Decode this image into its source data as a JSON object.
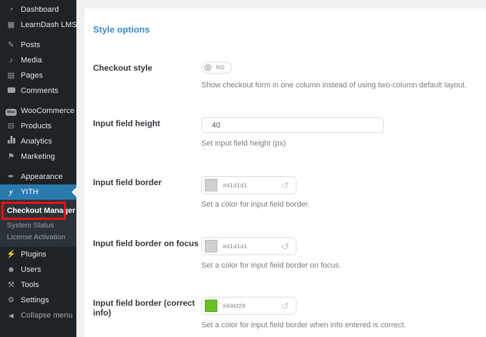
{
  "colors": {
    "sidebar_bg": "#1d2327",
    "submenu_bg": "#2c3338",
    "active_blue": "#2a7ab0",
    "heading_blue": "#3a8bc6",
    "annotation_red": "#f01111",
    "toggle_knob": "#d0d1d2",
    "border_gray_hex": "#d1d1d1",
    "correct_green_hex": "#69bf29"
  },
  "sidebar": {
    "items": [
      {
        "label": "Dashboard",
        "icon": "dashboard-icon",
        "glyph": "◔"
      },
      {
        "label": "LearnDash LMS",
        "icon": "learndash-icon",
        "glyph": "▦"
      },
      {
        "label": "Posts",
        "icon": "posts-pin-icon",
        "glyph": "✎"
      },
      {
        "label": "Media",
        "icon": "media-icon",
        "glyph": "♪"
      },
      {
        "label": "Pages",
        "icon": "pages-icon",
        "glyph": "▤"
      },
      {
        "label": "Comments",
        "icon": "comments-bubble-icon",
        "glyph": ""
      },
      {
        "label": "WooCommerce",
        "icon": "woocommerce-icon",
        "glyph": "Woo"
      },
      {
        "label": "Products",
        "icon": "products-icon",
        "glyph": "⊟"
      },
      {
        "label": "Analytics",
        "icon": "analytics-bars-icon",
        "glyph": ""
      },
      {
        "label": "Marketing",
        "icon": "marketing-megaphone-icon",
        "glyph": "⚑"
      },
      {
        "label": "Appearance",
        "icon": "appearance-brush-icon",
        "glyph": "✒"
      },
      {
        "label": "YITH",
        "icon": "yith-logo-icon",
        "glyph": "y"
      },
      {
        "label": "Plugins",
        "icon": "plugins-plug-icon",
        "glyph": "⚡"
      },
      {
        "label": "Users",
        "icon": "users-person-icon",
        "glyph": "☻"
      },
      {
        "label": "Tools",
        "icon": "tools-wrench-icon",
        "glyph": "⚒"
      },
      {
        "label": "Settings",
        "icon": "settings-sliders-icon",
        "glyph": "⚙"
      },
      {
        "label": "Collapse menu",
        "icon": "collapse-arrow-icon",
        "glyph": "◀"
      }
    ],
    "submenu": [
      {
        "label": "Checkout Manager"
      },
      {
        "label": "System Status"
      },
      {
        "label": "License Activation"
      }
    ]
  },
  "content": {
    "section_title": "Style options",
    "rows": [
      {
        "label": "Checkout style",
        "control": "toggle",
        "toggle_text": "NO",
        "description": "Show checkout form in one column instead of using two-column default layout."
      },
      {
        "label": "Input field height",
        "control": "input",
        "value": "40",
        "description": "Set input field height (px)"
      },
      {
        "label": "Input field border",
        "control": "color",
        "hex": "#d1d1d1",
        "description": "Set a color for input field border."
      },
      {
        "label": "Input field border on focus",
        "control": "color",
        "hex": "#d1d1d1",
        "description": "Set a color for input field border on focus."
      },
      {
        "label": "Input field border (correct info)",
        "control": "color",
        "hex": "#69bf29",
        "description": "Set a color for input field border when info entered is correct."
      }
    ],
    "reset_glyph": "↺"
  }
}
